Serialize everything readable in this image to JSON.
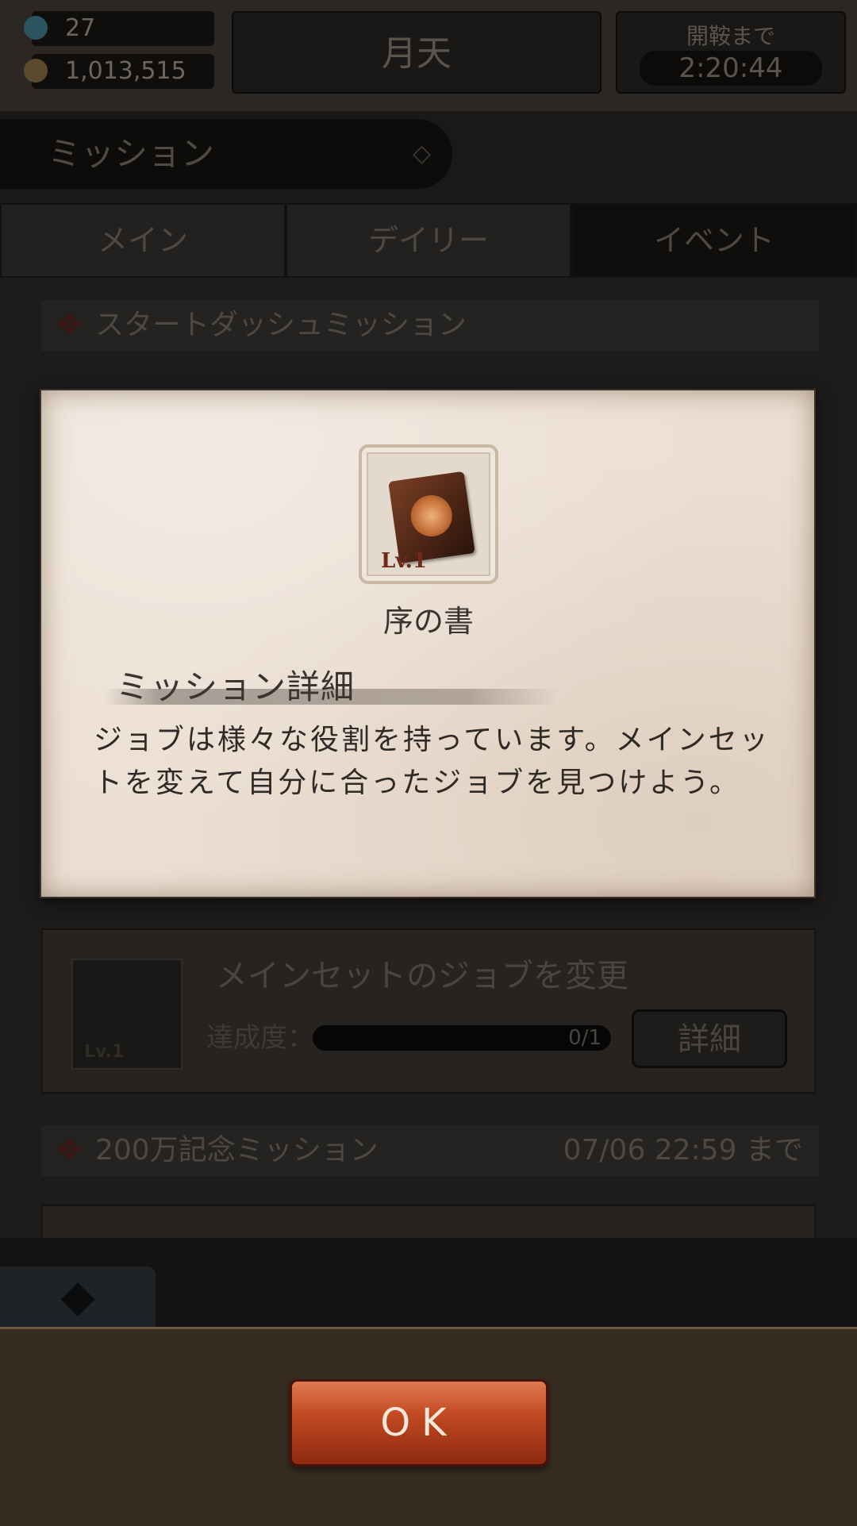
{
  "resources": {
    "gem": "27",
    "gold": "1,013,515"
  },
  "location": "月天",
  "timer": {
    "label": "開鞍まで",
    "value": "2:20:44"
  },
  "mission_header": "ミッション",
  "tabs": [
    {
      "label": "メイン"
    },
    {
      "label": "デイリー"
    },
    {
      "label": "イベント"
    }
  ],
  "sections": [
    {
      "title": "スタートダッシュミッション"
    },
    {
      "title": "200万記念ミッション",
      "deadline": "07/06 22:59 まで"
    }
  ],
  "mission_card": {
    "title": "メインセットのジョブを変更",
    "progress_label": "達成度：",
    "progress_value": "0/1",
    "detail_button": "詳細",
    "item_level": "Lv.1"
  },
  "modal": {
    "item_level": "Lv.1",
    "item_name": "序の書",
    "detail_title": "ミッション詳細",
    "detail_body": "ジョブは様々な役割を持っています。メインセットを変えて自分に合ったジョブを見つけよう。"
  },
  "ok_button": "OK",
  "colors": {
    "ok_button": "#c24a22",
    "parchment": "#ecdfd3",
    "dialog_bg": "#362c21"
  }
}
